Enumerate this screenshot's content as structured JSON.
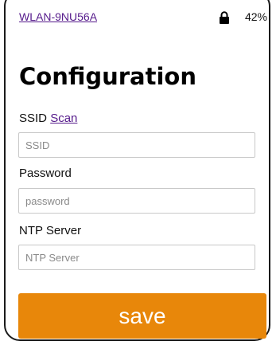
{
  "status_bar": {
    "network_name": "WLAN-9NU56A",
    "lock_icon": "lock-icon",
    "battery_percent": "42%"
  },
  "page_title": "Configuration",
  "ssid": {
    "label": "SSID",
    "scan_link": "Scan",
    "placeholder": "SSID",
    "value": ""
  },
  "password": {
    "label": "Password",
    "placeholder": "password",
    "value": ""
  },
  "ntp_server": {
    "label": "NTP Server",
    "placeholder": "NTP Server",
    "value": ""
  },
  "save_button": {
    "label": "save",
    "color": "#e8870a"
  }
}
